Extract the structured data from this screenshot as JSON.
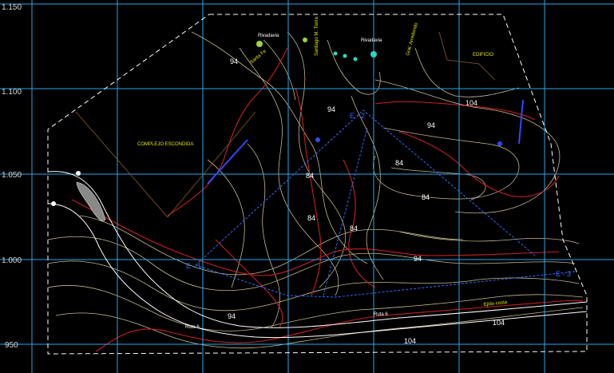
{
  "grid": {
    "y_labels": [
      "1.150",
      "1.100",
      "1.050",
      "1.000",
      "950"
    ]
  },
  "contour_labels": [
    "94",
    "94",
    "104",
    "94",
    "84",
    "84",
    "84",
    "84",
    "84",
    "94",
    "94",
    "104",
    "104"
  ],
  "place_labels": {
    "rivadavia_left": "Rivadavia",
    "rivadavia_right": "Rivadavia",
    "ruta_left": "Ruta 6",
    "ruta_center": "Ruta 6",
    "complejo": "COMPLEJO ESCONDIDA",
    "edificio": "EDIFICIO",
    "ejido": "Ejido costa",
    "street_a": "Santiago M. Tierra",
    "street_b": "Gral. Arredondo",
    "street_c": "Santa Fe"
  },
  "section_labels": {
    "e1": "E - 1",
    "e2": "E - 2",
    "e3": "E - 3"
  },
  "colors": {
    "background": "#000000",
    "grid": "#2aa7e6",
    "contour_major": "#cc1f1f",
    "contour_minor": "#e8d9a8",
    "boundary": "#ffffff",
    "section_line": "#2d6bff",
    "annotation": "#e6e600"
  }
}
